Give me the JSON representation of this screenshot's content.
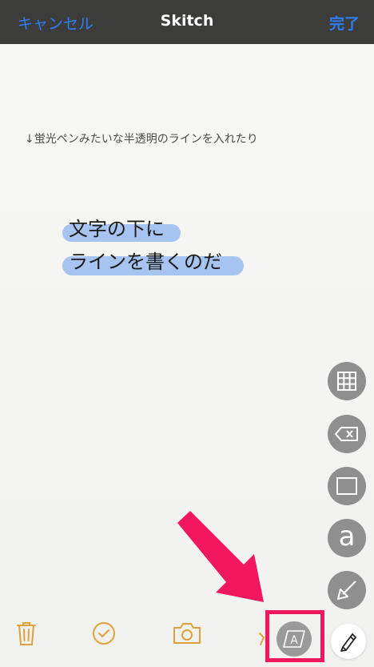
{
  "navbar": {
    "cancel_label": "キャンセル",
    "title": "Skitch",
    "done_label": "完了"
  },
  "canvas": {
    "caption": "↓蛍光ペンみたいな半透明のラインを入れたり",
    "handwritten_line1": "文字の下に",
    "handwritten_line2": "ラインを書くのだ"
  },
  "tool_panel": {
    "text_tool_glyph": "a",
    "selected_tool_glyph": "A"
  },
  "colors": {
    "navbar_bg": "#3c3c3b",
    "nav_accent": "#2f7ef6",
    "highlighter": "#78a5eb",
    "toolbar_icons": "#e0a13a",
    "annotation_arrow": "#f0175f"
  },
  "icons": [
    "pixelate-icon",
    "tag-icon",
    "rectangle-icon",
    "text-icon",
    "arrow-tool-icon",
    "trash-icon",
    "checkmark-icon",
    "camera-icon",
    "highlighter-tool-icon",
    "pen-icon"
  ]
}
